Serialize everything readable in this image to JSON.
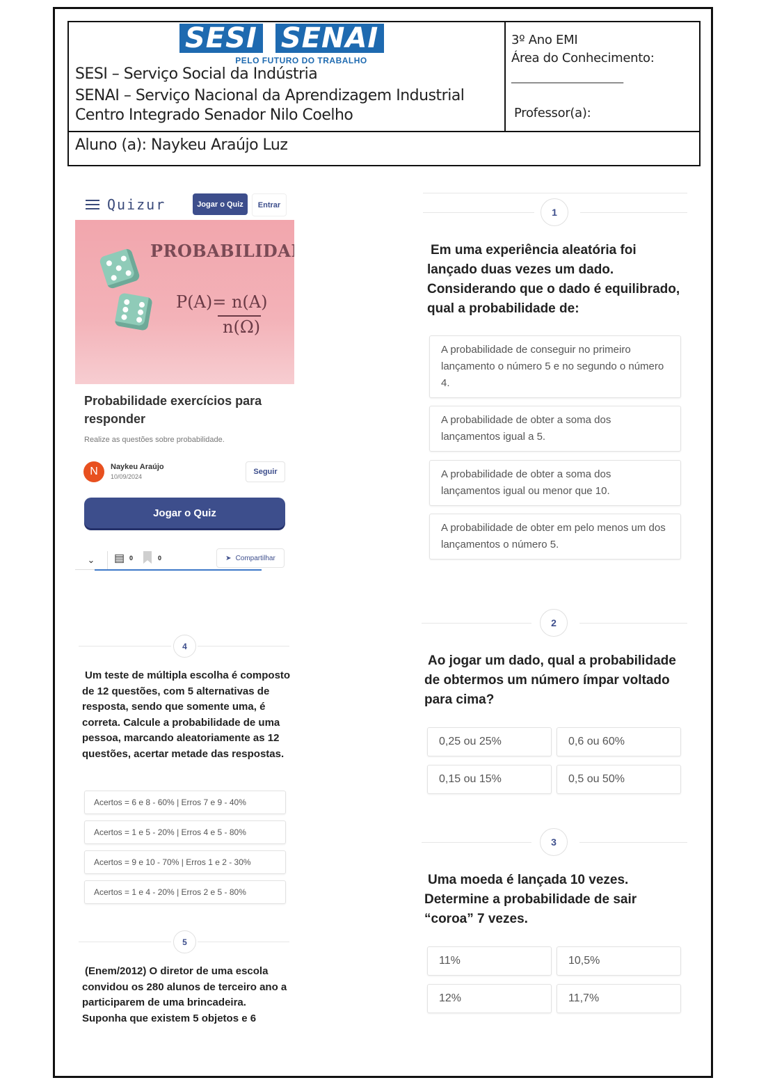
{
  "header": {
    "logo": {
      "left": "SESI",
      "right": "SENAI",
      "tagline": "PELO FUTURO DO TRABALHO",
      "color": "#1e6ab0"
    },
    "lines": [
      "SESI – Serviço Social da Indústria",
      "SENAI – Serviço Nacional da Aprendizagem Industrial",
      "Centro Integrado Senador Nilo Coelho"
    ],
    "grade": "3º Ano EMI",
    "area_label": "Área do Conhecimento:",
    "area_blank": "________________________",
    "teacher_label": "Professor(a):",
    "student": "Aluno (a): Naykeu Araújo Luz"
  },
  "quizur": {
    "brand": "Quizur",
    "play_top": "Jogar o Quiz",
    "enter": "Entrar",
    "image_title": "PROBABILIDADE",
    "formula_num": "P(A)= n(A)",
    "formula_den": "n(Ω)",
    "title": "Probabilidade exercícios para responder",
    "description": "Realize as questões sobre probabilidade.",
    "avatar_letter": "N",
    "author": "Naykeu Araújo",
    "date": "10/09/2024",
    "follow": "Seguir",
    "play_big": "Jogar o Quiz",
    "comments": "0",
    "bookmarks": "0",
    "share": "Compartilhar",
    "accent": "#3d4e8c"
  },
  "questions": {
    "q1": {
      "number": "1",
      "text": "Em uma experiência aleatória foi lançado duas vezes um dado. Considerando que o dado é equilibrado, qual a probabilidade de:",
      "options": [
        "A probabilidade de conseguir no primeiro lançamento o número 5 e no segundo o número 4.",
        "A probabilidade de obter a soma dos lançamentos igual a 5.",
        "A probabilidade de obter a soma dos lançamentos igual ou menor que 10.",
        "A probabilidade de obter em pelo menos um dos lançamentos o número 5."
      ]
    },
    "q2": {
      "number": "2",
      "text": "Ao jogar um dado, qual a probabilidade de obtermos um número ímpar voltado para cima?",
      "options": [
        "0,25 ou 25%",
        "0,6 ou 60%",
        "0,15 ou 15%",
        "0,5 ou 50%"
      ]
    },
    "q3": {
      "number": "3",
      "text": "Uma moeda é lançada 10 vezes. Determine a probabilidade de sair “coroa” 7 vezes.",
      "options": [
        "11%",
        "10,5%",
        "12%",
        "11,7%"
      ]
    },
    "q4": {
      "number": "4",
      "text": "Um teste de múltipla escolha é composto de 12 questões, com 5 alternativas de resposta, sendo que somente uma, é correta. Calcule a probabilidade de uma pessoa, marcando aleatoriamente as 12 questões, acertar metade das respostas.",
      "options": [
        "Acertos = 6 e 8 - 60% | Erros 7 e 9 - 40%",
        "Acertos = 1 e 5 - 20% | Erros 4 e 5 - 80%",
        "Acertos = 9 e 10 - 70% | Erros 1 e 2 - 30%",
        "Acertos = 1 e 4 - 20% | Erros 2 e 5 - 80%"
      ]
    },
    "q5": {
      "number": "5",
      "text": "(Enem/2012) O diretor de uma escola convidou os 280 alunos de terceiro ano a participarem de uma brincadeira. Suponha que existem 5 objetos e 6"
    }
  }
}
